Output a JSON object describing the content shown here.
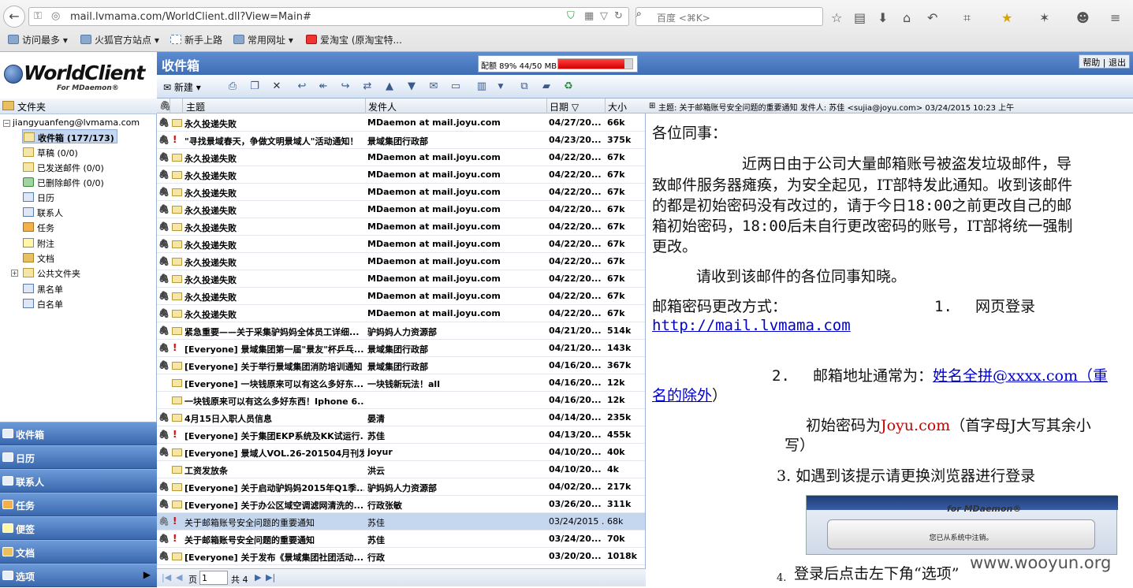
{
  "browser": {
    "url": "mail.lvmama.com/WorldClient.dll?View=Main#",
    "search_placeholder": "百度 <⌘K>",
    "bookmarks": [
      "访问最多",
      "火狐官方站点",
      "新手上路",
      "常用网址",
      "爱淘宝 (原淘宝特..."
    ]
  },
  "app": {
    "logo": "WorldClient",
    "logo_sub": "For MDaemon®",
    "folder_title": "收件箱",
    "quota_text": "配额 89% 44/50 MB",
    "quota_fraction": 0.89,
    "help_links": "帮助 | 退出",
    "toolbar": {
      "new_label": "新建"
    }
  },
  "sidebar": {
    "header": "文件夹",
    "account": "jiangyuanfeng@lvmama.com",
    "folders": [
      {
        "label": "收件箱 (177/173)"
      },
      {
        "label": "草稿 (0/0)"
      },
      {
        "label": "已发送邮件 (0/0)"
      },
      {
        "label": "已删除邮件 (0/0)"
      },
      {
        "label": "日历"
      },
      {
        "label": "联系人"
      },
      {
        "label": "任务"
      },
      {
        "label": "附注"
      },
      {
        "label": "文档"
      },
      {
        "label": "公共文件夹"
      },
      {
        "label": "黑名单"
      },
      {
        "label": "白名单"
      }
    ],
    "nav": [
      "收件箱",
      "日历",
      "联系人",
      "任务",
      "便签",
      "文档",
      "选项"
    ]
  },
  "list": {
    "columns": {
      "subject": "主题",
      "from": "发件人",
      "date": "日期",
      "size": "大小"
    },
    "rows": [
      {
        "subject": "永久投递失败",
        "from": "MDaemon at mail.joyu.com",
        "date": "04/27/20...",
        "size": "66k"
      },
      {
        "subject": "\"寻找景域春天，争做文明景域人\"活动通知！",
        "from": "景域集团行政部",
        "date": "04/23/20...",
        "size": "375k"
      },
      {
        "subject": "永久投递失败",
        "from": "MDaemon at mail.joyu.com",
        "date": "04/22/20...",
        "size": "67k"
      },
      {
        "subject": "永久投递失败",
        "from": "MDaemon at mail.joyu.com",
        "date": "04/22/20...",
        "size": "67k"
      },
      {
        "subject": "永久投递失败",
        "from": "MDaemon at mail.joyu.com",
        "date": "04/22/20...",
        "size": "67k"
      },
      {
        "subject": "永久投递失败",
        "from": "MDaemon at mail.joyu.com",
        "date": "04/22/20...",
        "size": "67k"
      },
      {
        "subject": "永久投递失败",
        "from": "MDaemon at mail.joyu.com",
        "date": "04/22/20...",
        "size": "67k"
      },
      {
        "subject": "永久投递失败",
        "from": "MDaemon at mail.joyu.com",
        "date": "04/22/20...",
        "size": "67k"
      },
      {
        "subject": "永久投递失败",
        "from": "MDaemon at mail.joyu.com",
        "date": "04/22/20...",
        "size": "67k"
      },
      {
        "subject": "永久投递失败",
        "from": "MDaemon at mail.joyu.com",
        "date": "04/22/20...",
        "size": "67k"
      },
      {
        "subject": "永久投递失败",
        "from": "MDaemon at mail.joyu.com",
        "date": "04/22/20...",
        "size": "67k"
      },
      {
        "subject": "永久投递失败",
        "from": "MDaemon at mail.joyu.com",
        "date": "04/22/20...",
        "size": "67k"
      },
      {
        "subject": "紧急重要——关于采集驴妈妈全体员工详细...",
        "from": "驴妈妈人力资源部",
        "date": "04/21/20...",
        "size": "514k"
      },
      {
        "subject": "[Everyone] 景域集团第一届\"景友\"杯乒乓...",
        "from": "景域集团行政部",
        "date": "04/21/20...",
        "size": "143k"
      },
      {
        "subject": "[Everyone] 关于举行景域集团消防培训通知",
        "from": "景域集团行政部",
        "date": "04/16/20...",
        "size": "367k"
      },
      {
        "subject": "[Everyone] 一块钱原来可以有这么多好东...",
        "from": "一块钱新玩法！all",
        "date": "04/16/20...",
        "size": "12k"
      },
      {
        "subject": "一块钱原来可以有这么多好东西！Iphone 6...",
        "from": "",
        "date": "04/16/20...",
        "size": "12k"
      },
      {
        "subject": "4月15日入职人员信息",
        "from": "晏清",
        "date": "04/14/20...",
        "size": "235k"
      },
      {
        "subject": "[Everyone] 关于集团EKP系统及KK试运行...",
        "from": "苏佳",
        "date": "04/13/20...",
        "size": "455k"
      },
      {
        "subject": "[Everyone] 景域人VOL.26-201504月刊发...",
        "from": "joyur",
        "date": "04/10/20...",
        "size": "40k"
      },
      {
        "subject": "工资发放条",
        "from": "洪云",
        "date": "04/10/20...",
        "size": "4k"
      },
      {
        "subject": "[Everyone] 关于启动驴妈妈2015年Q1季...",
        "from": "驴妈妈人力资源部",
        "date": "04/02/20...",
        "size": "217k"
      },
      {
        "subject": "[Everyone] 关于办公区域空调滤网清洗的...",
        "from": "行政张敏",
        "date": "03/26/20...",
        "size": "311k"
      },
      {
        "subject": "关于邮箱账号安全问题的重要通知",
        "from": "苏佳",
        "date": "03/24/2015 ...",
        "size": "68k"
      },
      {
        "subject": "关于邮箱账号安全问题的重要通知",
        "from": "苏佳",
        "date": "03/24/20...",
        "size": "70k"
      },
      {
        "subject": "[Everyone] 关于发布《景域集团社团活动...",
        "from": "行政",
        "date": "03/20/20...",
        "size": "1018k"
      }
    ],
    "pager": {
      "page_label": "页",
      "page_value": "1",
      "total_label": "共 4"
    }
  },
  "preview": {
    "header": "主题: 关于邮箱账号安全问题的重要通知  发件人: 苏佳 <sujia@joyu.com>  03/24/2015 10:23 上午",
    "greeting": "各位同事：",
    "p1_l1": "近两日由于公司大量邮箱账号被盗发垃圾邮件，导",
    "p1_l2": "致邮件服务器瘫痪，为安全起见，IT部特发此通知。收到该邮件",
    "p1_l3a": "的都是初始密码没有改过的，请于今日",
    "p1_l3b": "18:00",
    "p1_l3c": "之前更改自己的邮",
    "p1_l4a": "箱初始密码，",
    "p1_l4b": "18:00",
    "p1_l4c": "后未自行更改密码的账号，IT部将统一强制",
    "p1_l5": "更改。",
    "p2": "请收到该邮件的各位同事知晓。",
    "method_label": "邮箱密码更改方式：",
    "step1_num": "1.",
    "step1_text": "网页登录",
    "link": "http://mail.lvmama.com",
    "step2_num": "2.",
    "step2_text": "邮箱地址通常为：",
    "step2_link_a": "姓名全拼@xxxx.com（重",
    "step2_link_b": "名的除外",
    "step2_end": "）",
    "init_pw_label": "初始密码为",
    "init_pw_value": "Joyu.com",
    "init_pw_note_a": "（首字母J大写其余小",
    "init_pw_note_b": "写）",
    "step3": "3.  如遇到该提示请更换浏览器进行登录",
    "shot_sub": "for MDaemon®",
    "shot_btn": "您已从系统中注销。",
    "step4_num": "4.",
    "step4_text": "登录后点击左下角“选项”"
  },
  "watermark": "www.wooyun.org"
}
